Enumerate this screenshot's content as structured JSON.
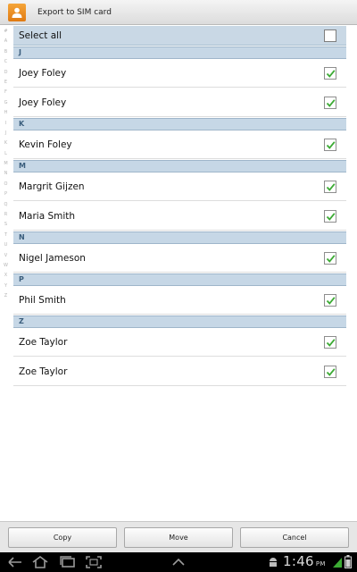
{
  "window": {
    "title": "Export to SIM card",
    "icon": "contacts-icon"
  },
  "index_letters": [
    "#",
    "A",
    "B",
    "C",
    "D",
    "E",
    "F",
    "G",
    "H",
    "I",
    "J",
    "K",
    "L",
    "M",
    "N",
    "O",
    "P",
    "Q",
    "R",
    "S",
    "T",
    "U",
    "V",
    "W",
    "X",
    "Y",
    "Z"
  ],
  "select_all": {
    "label": "Select all",
    "checked": false
  },
  "sections": [
    {
      "letter": "J",
      "contacts": [
        {
          "name": "Joey Foley",
          "checked": true
        },
        {
          "name": "Joey Foley",
          "checked": true
        }
      ]
    },
    {
      "letter": "K",
      "contacts": [
        {
          "name": "Kevin Foley",
          "checked": true
        }
      ]
    },
    {
      "letter": "M",
      "contacts": [
        {
          "name": "Margrit Gijzen",
          "checked": true
        },
        {
          "name": "Maria Smith",
          "checked": true
        }
      ]
    },
    {
      "letter": "N",
      "contacts": [
        {
          "name": "Nigel Jameson",
          "checked": true
        }
      ]
    },
    {
      "letter": "P",
      "contacts": [
        {
          "name": "Phil Smith",
          "checked": true
        }
      ]
    },
    {
      "letter": "Z",
      "contacts": [
        {
          "name": "Zoe Taylor",
          "checked": true
        },
        {
          "name": "Zoe Taylor",
          "checked": true
        }
      ]
    }
  ],
  "buttons": {
    "copy": "Copy",
    "move": "Move",
    "cancel": "Cancel"
  },
  "system_bar": {
    "nav_icons": [
      "back-icon",
      "home-icon",
      "recent-apps-icon",
      "screenshot-icon",
      "menu-up-icon"
    ],
    "status_icons": [
      "android-debug-icon",
      "signal-icon",
      "battery-icon"
    ],
    "time": "1:46",
    "time_suffix": "PM"
  },
  "colors": {
    "section_bg": "#c6d7e6",
    "check": "#3cab34",
    "system_bar": "#000000"
  }
}
